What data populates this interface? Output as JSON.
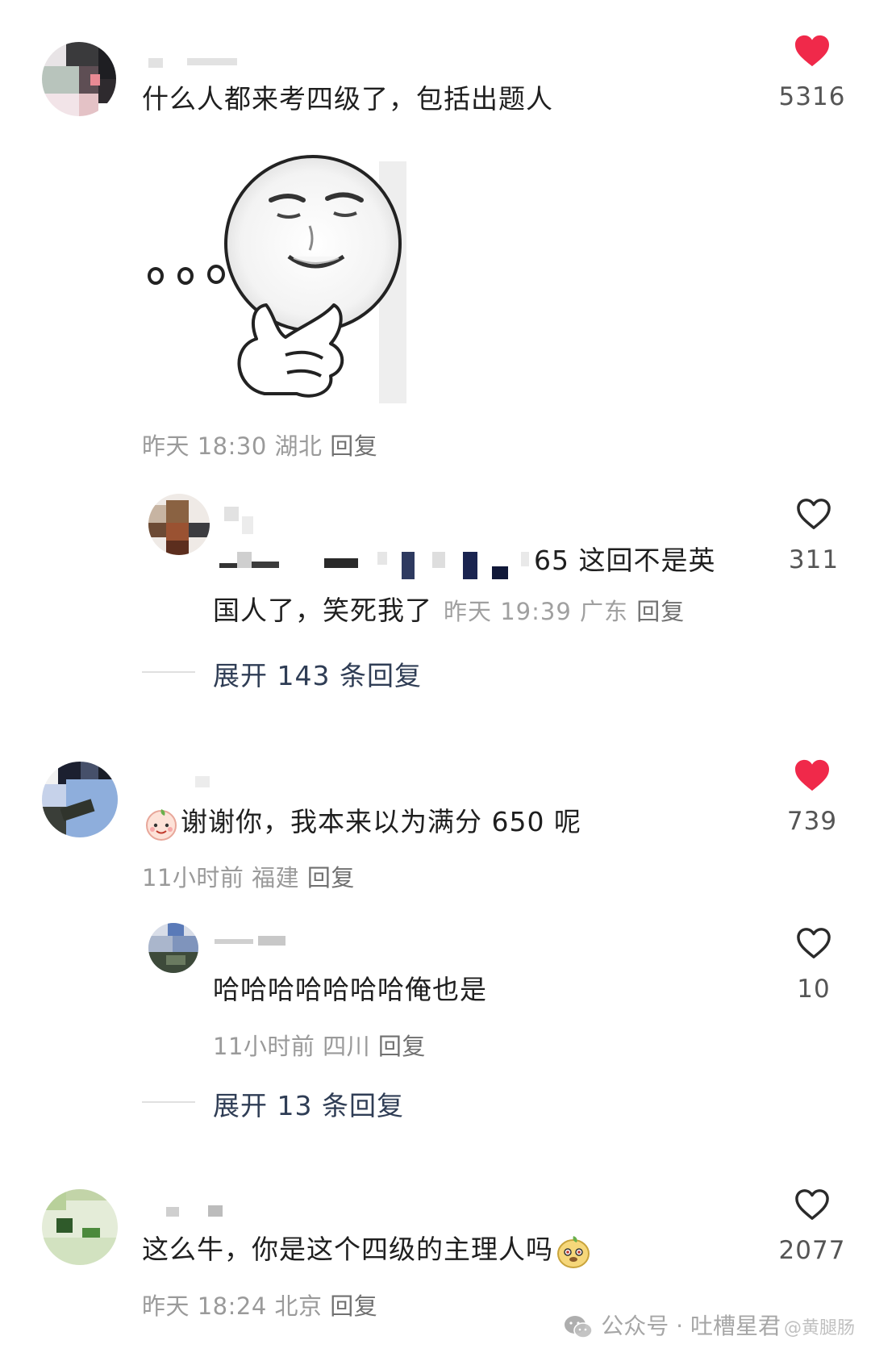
{
  "comments": [
    {
      "text": "什么人都来考四级了，包括出题人",
      "meta_time": "昨天 18:30",
      "meta_location": "湖北",
      "reply_label": "回复",
      "likes": "5316",
      "liked": true
    },
    {
      "text_line1": "65 这回不是英",
      "text_line2": "国人了，笑死我了",
      "meta_time": "昨天 19:39",
      "meta_location": "广东",
      "reply_label": "回复",
      "likes": "311",
      "liked": false
    },
    {
      "expand_label": "展开 143 条回复"
    },
    {
      "text": "谢谢你，我本来以为满分 650 呢",
      "meta_time": "11小时前",
      "meta_location": "福建",
      "reply_label": "回复",
      "likes": "739",
      "liked": true
    },
    {
      "text": "哈哈哈哈哈哈哈俺也是",
      "meta_time": "11小时前",
      "meta_location": "四川",
      "reply_label": "回复",
      "likes": "10",
      "liked": false
    },
    {
      "expand_label": "展开 13 条回复"
    },
    {
      "text": "这么牛，你是这个四级的主理人吗",
      "meta_time": "昨天 18:24",
      "meta_location": "北京",
      "reply_label": "回复",
      "likes": "2077",
      "liked": false
    }
  ],
  "watermark": {
    "text": "公众号 · 吐槽星君",
    "sub": "@黄腿肠"
  },
  "colors": {
    "heart_liked": "#f0294a",
    "heart_outline": "#2a2a2a",
    "expand_text": "#2f3d55",
    "meta_text": "#9a9a9a"
  },
  "icons": [
    "heart-filled-icon",
    "heart-outline-icon",
    "wechat-icon"
  ]
}
